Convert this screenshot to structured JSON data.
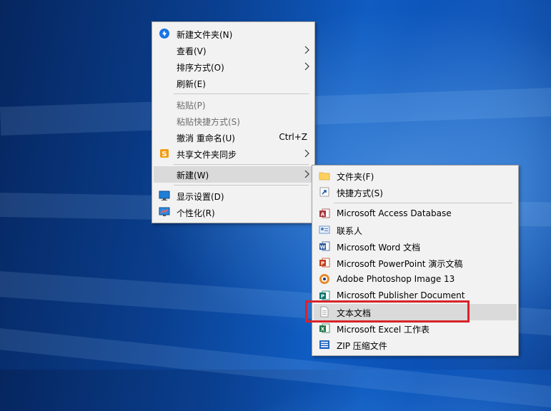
{
  "context_menu": {
    "items": [
      {
        "label": "新建文件夹(N)",
        "icon": "new-folder-sync-icon"
      },
      {
        "label": "查看(V)",
        "submenu": true
      },
      {
        "label": "排序方式(O)",
        "submenu": true
      },
      {
        "label": "刷新(E)"
      },
      {
        "label": "粘贴(P)",
        "disabled": true
      },
      {
        "label": "粘贴快捷方式(S)",
        "disabled": true
      },
      {
        "label": "撤消 重命名(U)",
        "shortcut": "Ctrl+Z"
      },
      {
        "label": "共享文件夹同步",
        "icon": "shared-folder-sync-icon",
        "submenu": true
      },
      {
        "label": "新建(W)",
        "submenu": true,
        "highlighted": true
      },
      {
        "label": "显示设置(D)",
        "icon": "display-settings-icon"
      },
      {
        "label": "个性化(R)",
        "icon": "personalize-icon"
      }
    ]
  },
  "new_submenu": {
    "items": [
      {
        "label": "文件夹(F)",
        "icon": "folder-icon"
      },
      {
        "label": "快捷方式(S)",
        "icon": "shortcut-icon"
      },
      {
        "label": "Microsoft Access Database",
        "icon": "access-icon"
      },
      {
        "label": "联系人",
        "icon": "contact-icon"
      },
      {
        "label": "Microsoft Word 文档",
        "icon": "word-icon"
      },
      {
        "label": "Microsoft PowerPoint 演示文稿",
        "icon": "powerpoint-icon"
      },
      {
        "label": "Adobe Photoshop Image 13",
        "icon": "photoshop-icon"
      },
      {
        "label": "Microsoft Publisher Document",
        "icon": "publisher-icon"
      },
      {
        "label": "文本文档",
        "icon": "text-document-icon",
        "highlighted": true
      },
      {
        "label": "Microsoft Excel 工作表",
        "icon": "excel-icon"
      },
      {
        "label": "ZIP 压缩文件",
        "icon": "zip-icon"
      }
    ]
  },
  "colors": {
    "menu_bg": "#f2f2f2",
    "highlight": "#dadada",
    "annotation_red": "#d8232a",
    "desktop_blue": "#0f5cc2"
  }
}
